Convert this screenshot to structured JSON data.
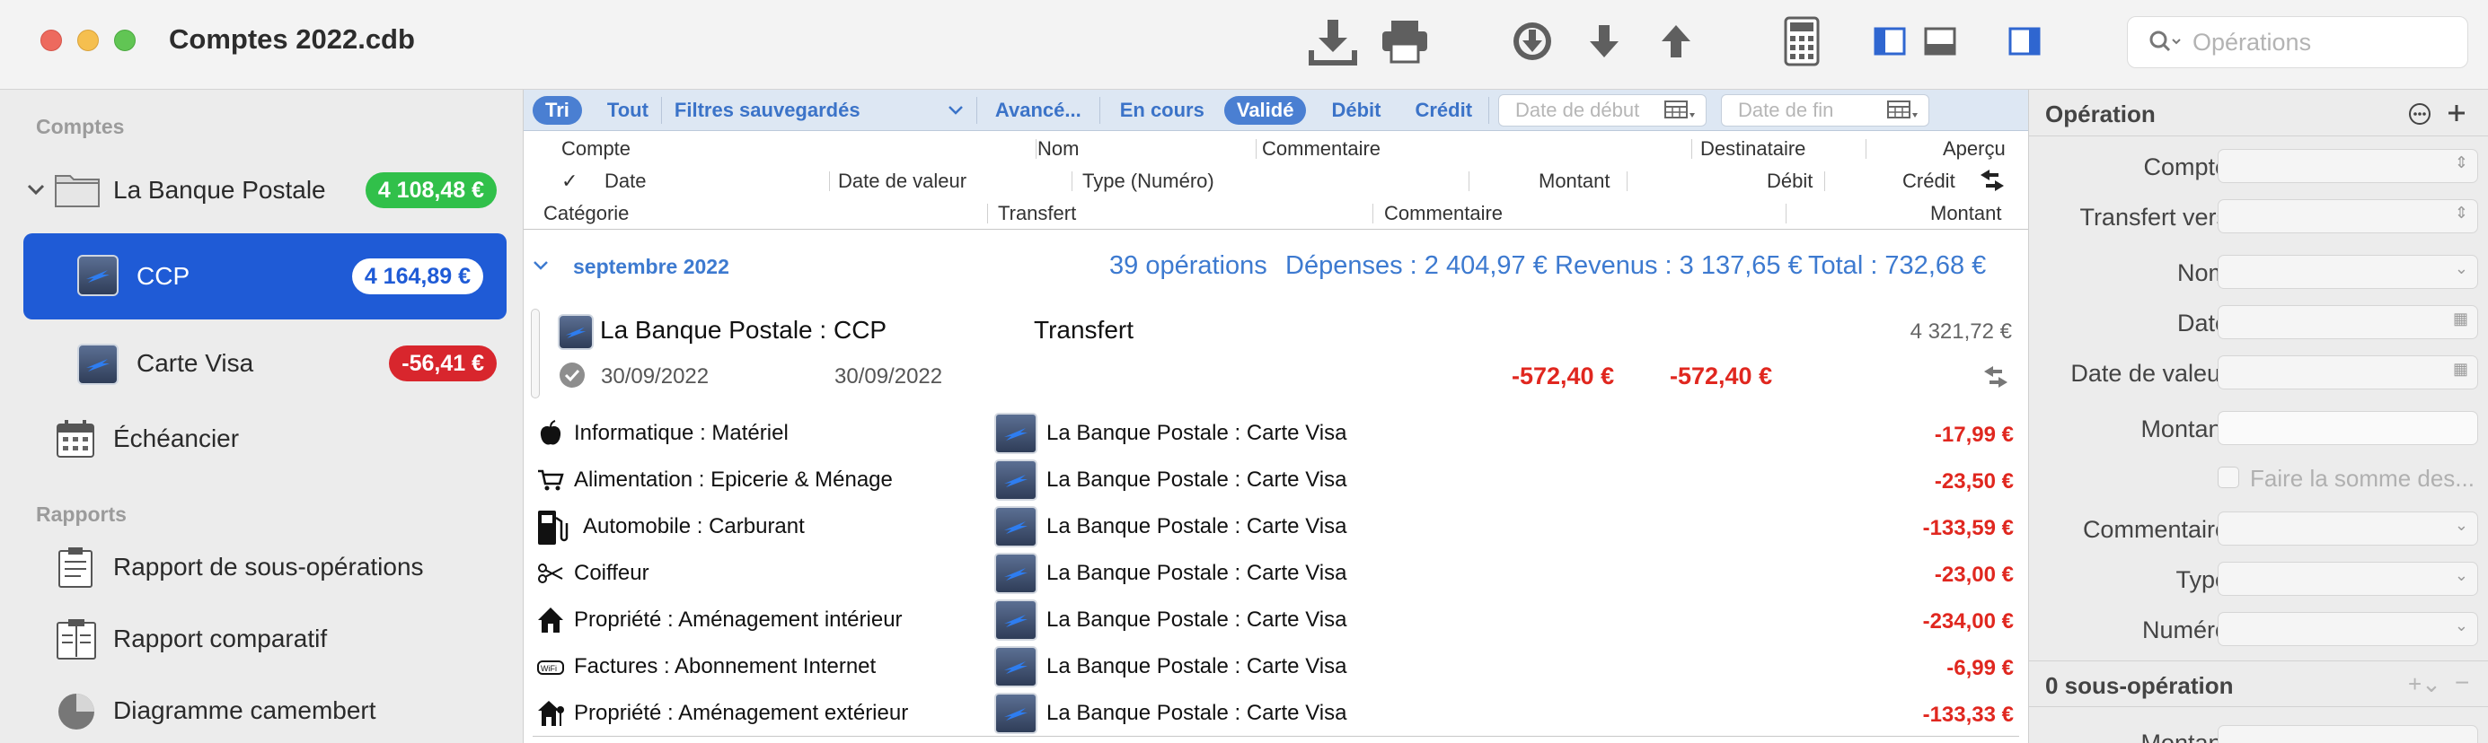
{
  "window": {
    "title": "Comptes 2022.cdb"
  },
  "search": {
    "placeholder": "Opérations"
  },
  "sidebar": {
    "section_accounts": "Comptes",
    "bank_group": {
      "label": "La Banque Postale",
      "balance": "4 108,48 €"
    },
    "accounts": [
      {
        "label": "CCP",
        "balance": "4 164,89 €"
      },
      {
        "label": "Carte Visa",
        "balance": "-56,41 €"
      }
    ],
    "scheduler": {
      "label": "Échéancier"
    },
    "section_reports": "Rapports",
    "reports": [
      {
        "label": "Rapport de sous-opérations"
      },
      {
        "label": "Rapport comparatif"
      },
      {
        "label": "Diagramme camembert"
      }
    ]
  },
  "filterbar": {
    "sort": "Tri",
    "all": "Tout",
    "saved_filters": "Filtres sauvegardés",
    "advanced": "Avancé...",
    "pending": "En cours",
    "validated": "Validé",
    "debit": "Débit",
    "credit": "Crédit",
    "start_date": "Date de début",
    "end_date": "Date de fin"
  },
  "columns": {
    "row1": {
      "account": "Compte",
      "name": "Nom",
      "comment": "Commentaire",
      "recipient": "Destinataire",
      "preview": "Aperçu"
    },
    "row2": {
      "check": "✓",
      "date": "Date",
      "value_date": "Date de valeur",
      "type": "Type (Numéro)",
      "amount": "Montant",
      "debit": "Débit",
      "credit": "Crédit"
    },
    "row3": {
      "category": "Catégorie",
      "transfer": "Transfert",
      "comment": "Commentaire",
      "amount": "Montant"
    }
  },
  "group": {
    "title": "septembre 2022",
    "count": "39 opérations",
    "expenses": "Dépenses : 2 404,97 €",
    "income": "Revenus : 3 137,65 €",
    "total": "Total : 732,68 €"
  },
  "operation": {
    "account": "La Banque Postale : CCP",
    "name": "Transfert",
    "balance": "4 321,72 €",
    "date": "30/09/2022",
    "value_date": "30/09/2022",
    "amount": "-572,40 €",
    "debit": "-572,40 €"
  },
  "splits": [
    {
      "icon": "apple-icon",
      "category": "Informatique : Matériel",
      "transfer": "La Banque Postale : Carte Visa",
      "amount": "-17,99 €"
    },
    {
      "icon": "cart-icon",
      "category": "Alimentation : Epicerie & Ménage",
      "transfer": "La Banque Postale : Carte Visa",
      "amount": "-23,50 €"
    },
    {
      "icon": "fuel-pump-icon",
      "category": "Automobile : Carburant",
      "transfer": "La Banque Postale : Carte Visa",
      "amount": "-133,59 €"
    },
    {
      "icon": "scissors-icon",
      "category": "Coiffeur",
      "transfer": "La Banque Postale : Carte Visa",
      "amount": "-23,00 €"
    },
    {
      "icon": "house-icon",
      "category": "Propriété : Aménagement intérieur",
      "transfer": "La Banque Postale : Carte Visa",
      "amount": "-234,00 €"
    },
    {
      "icon": "wifi-router-icon",
      "category": "Factures : Abonnement Internet",
      "transfer": "La Banque Postale : Carte Visa",
      "amount": "-6,99 €"
    },
    {
      "icon": "house-garden-icon",
      "category": "Propriété : Aménagement extérieur",
      "transfer": "La Banque Postale : Carte Visa",
      "amount": "-133,33 €"
    }
  ],
  "inspector": {
    "title": "Opération",
    "fields": {
      "account": "Compte",
      "transfer_to": "Transfert vers",
      "name": "Nom",
      "date": "Date",
      "value_date": "Date de valeur",
      "amount": "Montant",
      "sum_checkbox": "Faire la somme des...",
      "comment": "Commentaire",
      "type": "Type",
      "number": "Numéro"
    },
    "sub_title": "0 sous-opération",
    "sub_amount": "Montant"
  },
  "colors": {
    "accent": "#1f5bd6",
    "positive": "#31c04a",
    "negative": "#d8262d",
    "link": "#3d7ad0"
  }
}
